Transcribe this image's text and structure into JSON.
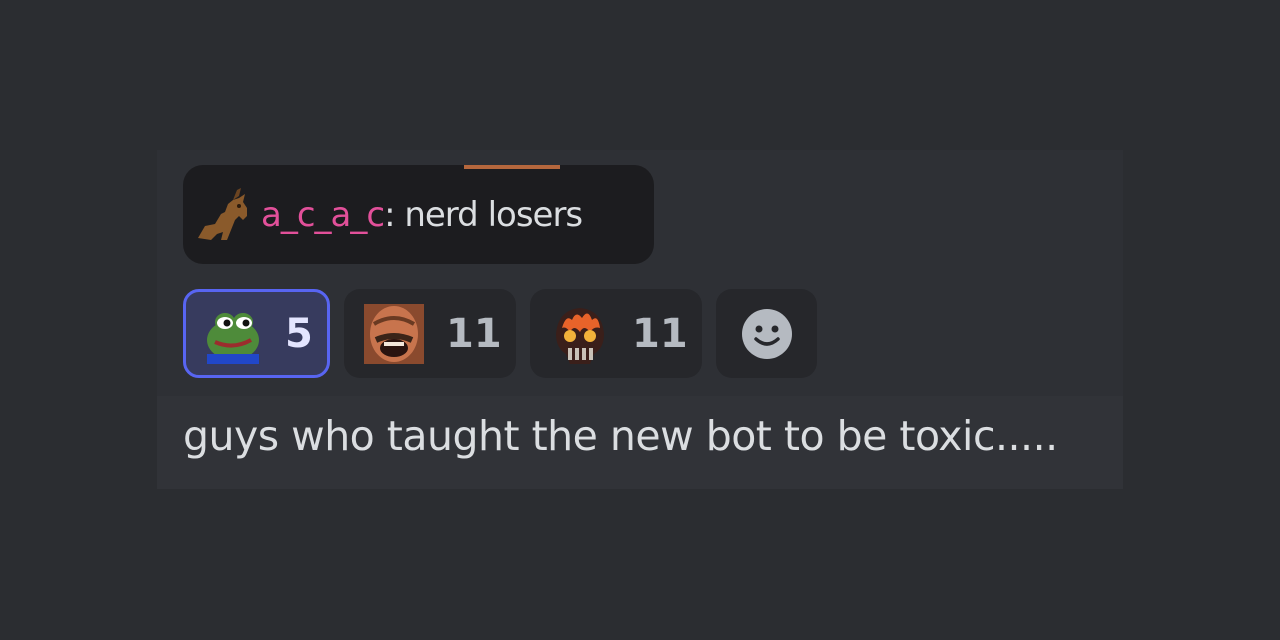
{
  "quote": {
    "username": "a_c_a_c",
    "separator": ":",
    "text": " nerd losers",
    "icon": "goat-icon"
  },
  "reactions": [
    {
      "emoji": "pepe-frog-emoji",
      "count": "5",
      "active": true
    },
    {
      "emoji": "laughing-man-emoji",
      "count": "11",
      "active": false
    },
    {
      "emoji": "flaming-skull-emoji",
      "count": "11",
      "active": false
    }
  ],
  "add_reaction": {
    "icon": "smile-icon"
  },
  "message": {
    "content": "guys who taught the new bot to be toxic....."
  },
  "colors": {
    "background": "#2b2d31",
    "username": "#e2509a",
    "active_border": "#5865f2"
  }
}
